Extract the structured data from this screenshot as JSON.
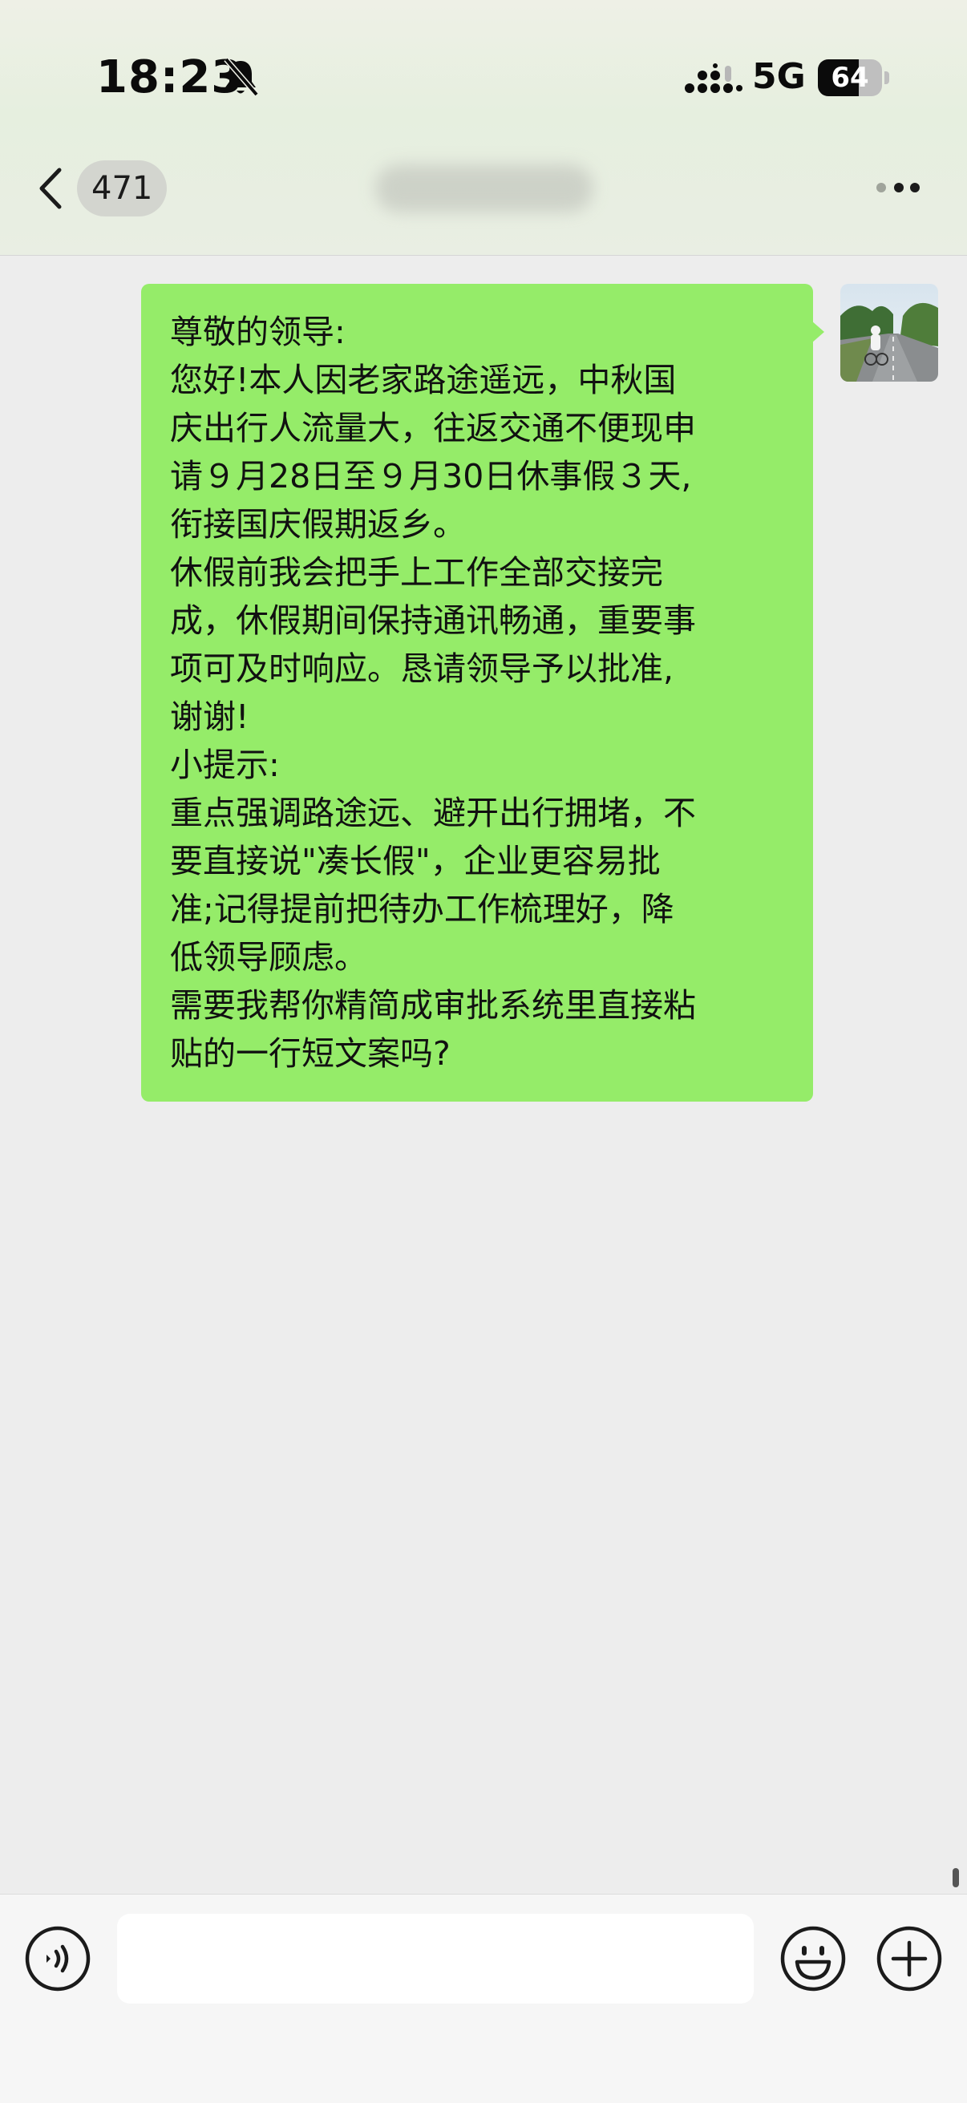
{
  "status_bar": {
    "time": "18:23",
    "network": "5G",
    "battery_level": "64",
    "battery_fraction": 0.64
  },
  "nav": {
    "unread_count": "471"
  },
  "message": {
    "lines": [
      "尊敬的领导:",
      "您好!本人因老家路途遥远，中秋国",
      "庆出行人流量大，往返交通不便现申",
      "请９月28日至９月30日休事假３天,",
      "衔接国庆假期返乡。",
      "休假前我会把手上工作全部交接完",
      "成，休假期间保持通讯畅通，重要事",
      "项可及时响应。恳请领导予以批准,",
      "谢谢!",
      "小提示:",
      "重点强调路途远、避开出行拥堵，不",
      "要直接说\"凑长假\"，企业更容易批",
      "准;记得提前把待办工作梳理好，降",
      "低领导顾虑。",
      "需要我帮你精简成审批系统里直接粘",
      "贴的一行短文案吗?"
    ]
  },
  "input": {
    "value": "",
    "placeholder": ""
  },
  "colors": {
    "bubble": "#95ec69",
    "chat_background": "#ededed",
    "input_bar": "#f6f6f6"
  }
}
